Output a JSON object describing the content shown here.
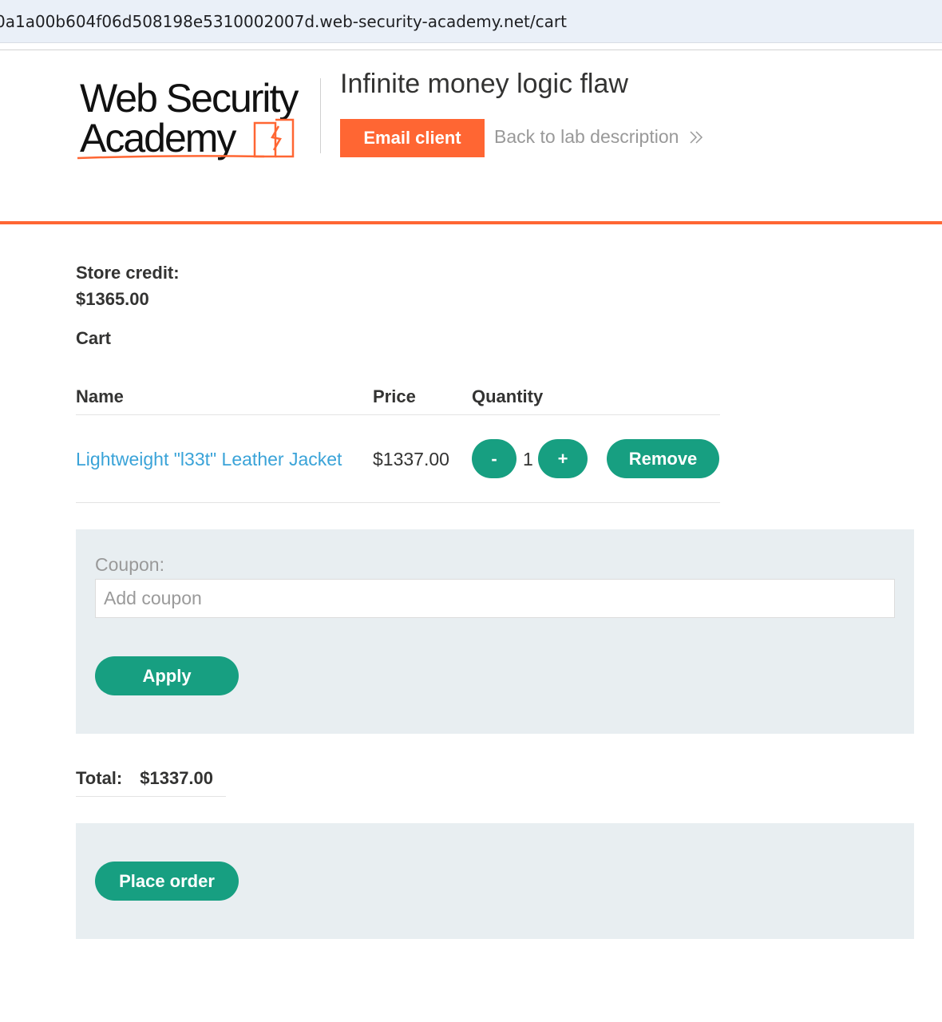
{
  "browser": {
    "url": "0a1a00b604f06d508198e5310002007d.web-security-academy.net/cart"
  },
  "header": {
    "logo_alt": "Web Security Academy",
    "lab_title": "Infinite money logic flaw",
    "email_client_label": "Email client",
    "back_link_label": "Back to lab description",
    "accent_color": "#ff6633"
  },
  "store": {
    "credit_label": "Store credit:",
    "credit_value": "$1365.00",
    "cart_heading": "Cart"
  },
  "cart": {
    "columns": [
      "Name",
      "Price",
      "Quantity"
    ],
    "items": [
      {
        "name": "Lightweight \"l33t\" Leather Jacket",
        "price": "$1337.00",
        "decrement_label": "-",
        "quantity": "1",
        "increment_label": "+",
        "remove_label": "Remove"
      }
    ]
  },
  "coupon": {
    "label": "Coupon:",
    "placeholder": "Add coupon",
    "value": "",
    "apply_label": "Apply"
  },
  "total": {
    "label": "Total:",
    "value": "$1337.00"
  },
  "order": {
    "place_order_label": "Place order"
  },
  "colors": {
    "button_green": "#179f81",
    "link_blue": "#3aa3d8",
    "panel_gray": "#e8eef1"
  }
}
